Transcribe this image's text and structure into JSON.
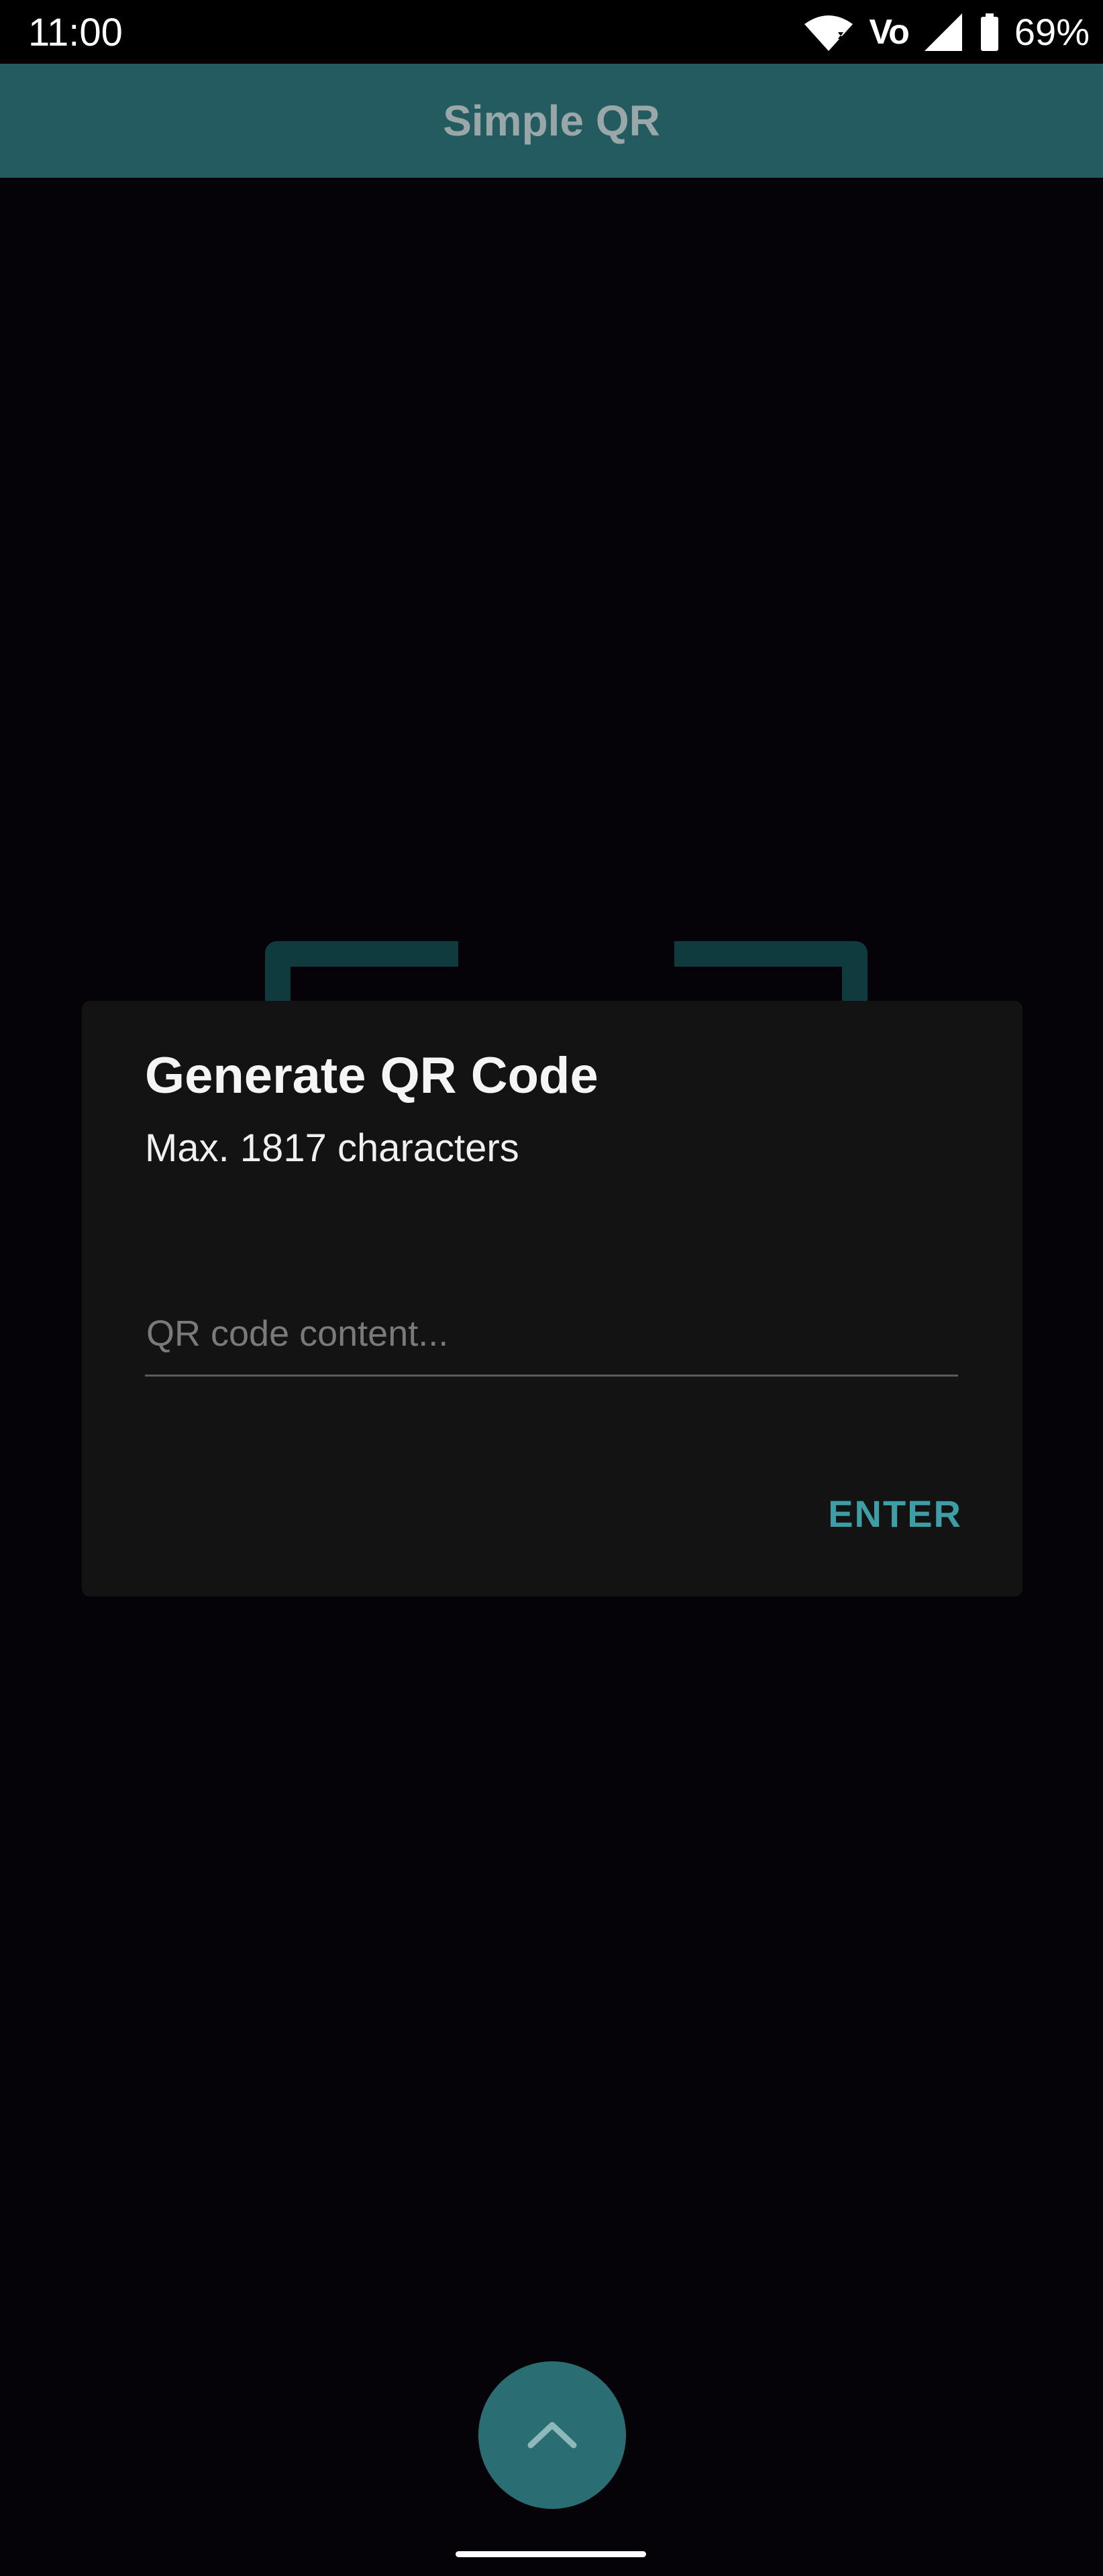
{
  "status_bar": {
    "time": "11:00",
    "battery_percent": "69%",
    "network_label": "Vo",
    "icons": [
      "wifi-icon",
      "volte-icon",
      "signal-icon",
      "battery-icon"
    ]
  },
  "app_bar": {
    "title": "Simple QR"
  },
  "dialog": {
    "title": "Generate QR Code",
    "subtitle": "Max. 1817 characters",
    "input": {
      "value": "",
      "placeholder": "QR code content..."
    },
    "enter_label": "ENTER"
  },
  "fab": {
    "icon": "chevron-up-icon"
  },
  "colors": {
    "accent": "#3e9ea6",
    "app_bar": "#235b60",
    "dialog_bg": "#131313",
    "background": "#050307"
  }
}
